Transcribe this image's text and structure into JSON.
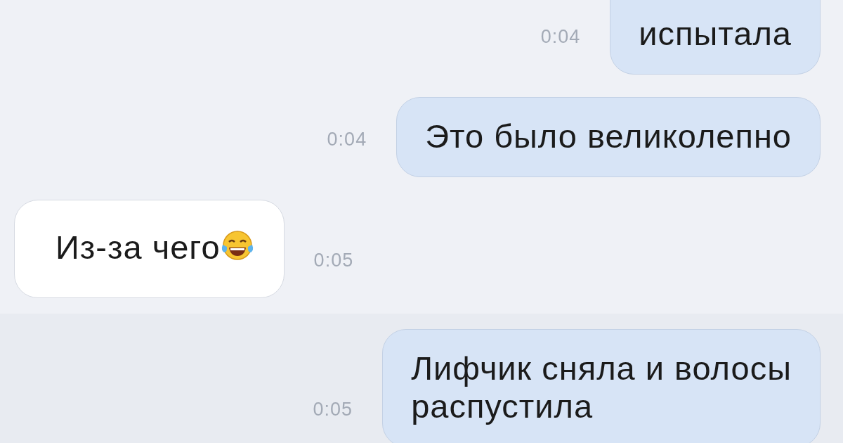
{
  "messages": [
    {
      "kind": "outgoing",
      "lines": [
        "испытала"
      ],
      "time": "0:04",
      "emoji": false
    },
    {
      "kind": "outgoing",
      "lines": [
        "Это было великолепно"
      ],
      "time": "0:04",
      "emoji": false
    },
    {
      "kind": "incoming",
      "lines": [
        "Из-за чего"
      ],
      "time": "0:05",
      "emoji": true
    },
    {
      "kind": "outgoing",
      "lines": [
        "Лифчик сняла и волосы",
        "распустила"
      ],
      "time": "0:05",
      "emoji": false
    }
  ]
}
